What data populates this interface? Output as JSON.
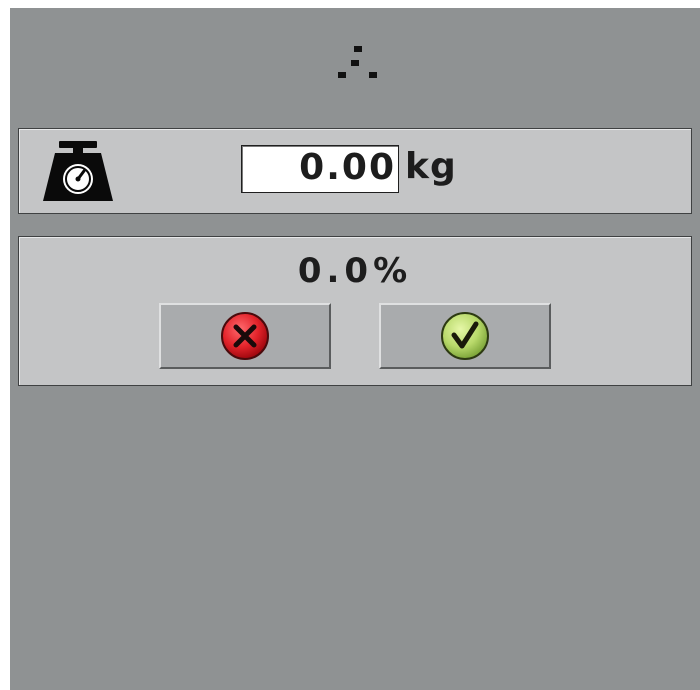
{
  "icons": {
    "loading": "loading-dots-icon",
    "scale": "weighing-scale-icon",
    "cancel": "cancel-x-icon",
    "confirm": "confirm-check-icon"
  },
  "weight": {
    "value": "0.00",
    "unit": "kg"
  },
  "percent": {
    "value": "0.0%"
  },
  "colors": {
    "screen_background": "#8f9293",
    "panel_background": "#c4c5c6",
    "cancel_red": "#e2232a",
    "confirm_green": "#b8d96a"
  }
}
